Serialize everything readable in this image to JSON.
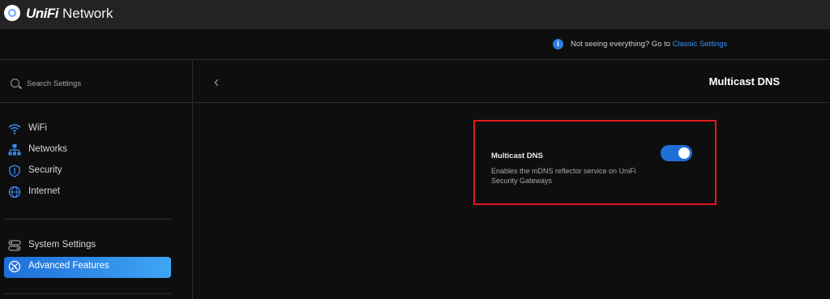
{
  "app": {
    "brand_prefix": "UniFi",
    "brand_suffix": "Network"
  },
  "info": {
    "text": "Not seeing everything? Go to ",
    "link": "Classic Settings",
    "icon": "info-icon"
  },
  "search": {
    "label": "Search Settings"
  },
  "sidebar": {
    "items": [
      {
        "label": "WiFi",
        "icon": "wifi-icon"
      },
      {
        "label": "Networks",
        "icon": "network-icon"
      },
      {
        "label": "Security",
        "icon": "shield-icon"
      },
      {
        "label": "Internet",
        "icon": "globe-icon"
      },
      {
        "label": "System Settings",
        "icon": "toggles-icon"
      },
      {
        "label": "Advanced Features",
        "icon": "advanced-icon",
        "active": true
      }
    ]
  },
  "page": {
    "title": "Multicast DNS",
    "back_icon": "chevron-left-icon"
  },
  "setting": {
    "title": "Multicast DNS",
    "description": "Enables the mDNS reflector service on UniFi Security Gateways",
    "enabled": true
  },
  "colors": {
    "accent": "#1f6fd8",
    "highlight_border": "#e0181f",
    "link": "#3c8cf0"
  }
}
